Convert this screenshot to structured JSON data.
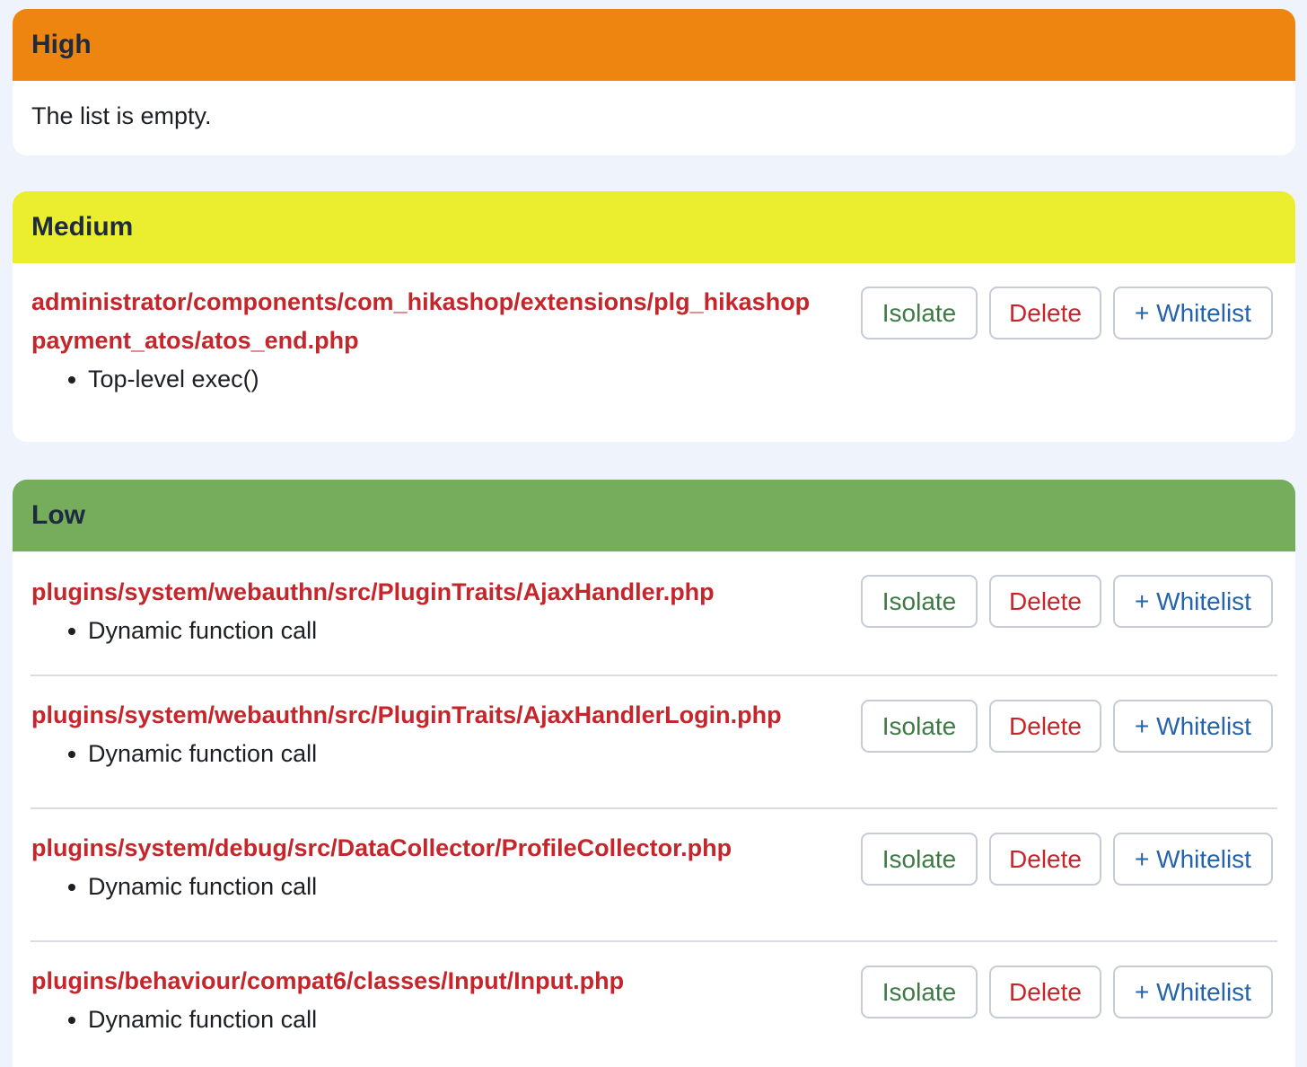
{
  "sections": {
    "high": {
      "title": "High",
      "empty_text": "The list is empty."
    },
    "medium": {
      "title": "Medium",
      "items": [
        {
          "path": "administrator/components/com_hikashop/extensions/plg_hikashop payment_atos/atos_end.php",
          "reasons": [
            "Top-level exec()"
          ]
        }
      ]
    },
    "low": {
      "title": "Low",
      "items": [
        {
          "path": "plugins/system/webauthn/src/PluginTraits/AjaxHandler.php",
          "reasons": [
            "Dynamic function call"
          ]
        },
        {
          "path": "plugins/system/webauthn/src/PluginTraits/AjaxHandlerLogin.php",
          "reasons": [
            "Dynamic function call"
          ]
        },
        {
          "path": "plugins/system/debug/src/DataCollector/ProfileCollector.php",
          "reasons": [
            "Dynamic function call"
          ]
        },
        {
          "path": "plugins/behaviour/compat6/classes/Input/Input.php",
          "reasons": [
            "Dynamic function call"
          ]
        }
      ]
    }
  },
  "buttons": {
    "isolate": "Isolate",
    "delete": "Delete",
    "whitelist": "+ Whitelist"
  },
  "colors": {
    "high": "#ee8511",
    "medium": "#ebee2e",
    "low": "#75ad5d",
    "path": "#c4262b",
    "isolate": "#3e7a46",
    "delete": "#c4262b",
    "whitelist": "#2563ab"
  }
}
